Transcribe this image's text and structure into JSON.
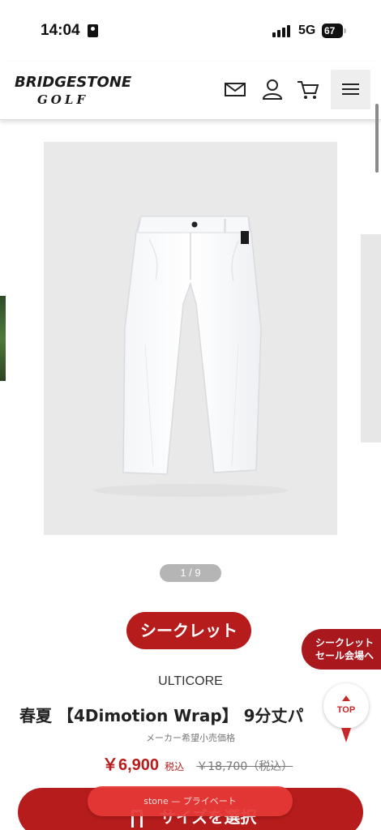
{
  "status_bar": {
    "time": "14:04",
    "network": "5G",
    "battery": "67"
  },
  "header": {
    "logo_top": "BRIDGESTONE",
    "logo_bottom": "GOLF",
    "icons": [
      "mail-icon",
      "user-icon",
      "cart-icon",
      "menu-icon"
    ]
  },
  "carousel": {
    "pager": "1 / 9",
    "current": 1,
    "total": 9
  },
  "product": {
    "badge": "シークレット",
    "brand": "ULTICORE",
    "title": "春夏 【4Dimotion Wrap】 9分丈パ",
    "msrp_label": "メーカー希望小売価格",
    "price_sale": "￥6,900",
    "price_tax": "税込",
    "price_original": "￥18,700（税込）"
  },
  "sale_tab": {
    "line1": "シークレット",
    "line2": "セール会場へ"
  },
  "top_button": {
    "label": "TOP"
  },
  "cart_bar": {
    "label": "サイズを選択"
  },
  "url_pill": {
    "text": "stone — プライベート"
  },
  "colors": {
    "accent_red": "#b71c1c",
    "sale_tab_red": "#a8181c",
    "top_red": "#c62828"
  }
}
